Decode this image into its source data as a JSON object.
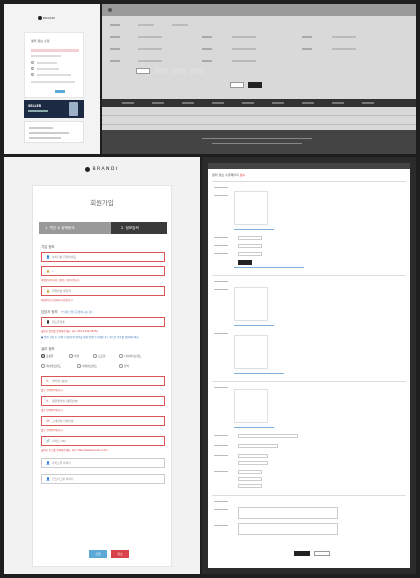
{
  "signup": {
    "brand_name": "BRANDI",
    "page_title": "회원가입",
    "steps": [
      {
        "label": "1. 약관 & 정책동의"
      },
      {
        "label": "2. 정보입력"
      }
    ],
    "section_basic": "가입 정보",
    "section_manager": "담당자 정보",
    "section_manager_sub": "(*실제 샵을 운영하시는 분)",
    "section_shop": "셀러 정보",
    "fields": [
      {
        "icon": "user-icon",
        "glyph": "👤",
        "text": "아이디를 입력하세요",
        "error": true
      },
      {
        "icon": "lock-icon",
        "glyph": "🔒",
        "text": "•",
        "error": true
      },
      {
        "icon": "lock-icon",
        "glyph": "🔒",
        "text": "비밀번호 재입력",
        "error": true
      },
      {
        "icon": "phone-icon",
        "glyph": "📱",
        "text": "핸드폰번호",
        "error": true
      },
      {
        "icon": "pencil-icon",
        "glyph": "✎",
        "text": "셀러명 (상호)",
        "error": true
      },
      {
        "icon": "pencil-icon",
        "glyph": "✎",
        "text": "영문셀러명 (영문상호)",
        "error": true
      },
      {
        "icon": "phone-icon",
        "glyph": "☏",
        "text": "고객센터 전화번호",
        "error": true
      },
      {
        "icon": "link-icon",
        "glyph": "🔗",
        "text": "사이트 URL",
        "error": true
      },
      {
        "icon": "user-icon",
        "glyph": "👤",
        "text": "카카오톡 아이디",
        "error": false
      },
      {
        "icon": "user-icon",
        "glyph": "👤",
        "text": "인스타그램 아이디",
        "error": false
      }
    ],
    "errors": {
      "id": "아이디의 최소 길이는 5글자입니다.",
      "pw": "비밀번호의 최소 길이는 4글자입니다.",
      "pw2": "비밀번호가 일치하지 않습니다.",
      "phone": "올바른 정보를 입력해주세요. (ex. 010-1234-5678)",
      "name": "필수 입력항목입니다.",
      "name_en": "필수 입력항목입니다.",
      "cs": "필수 입력항목입니다.",
      "url": "올바른 주소를 입력해주세요. (ex. http://www.brandi.co.kr)"
    },
    "manager_note": "● 입점 신청 후 브랜디 담당자와 연락을 통해 입점이 진행됩니다. 핸드폰 번호를 확인해주세요.",
    "shop_types": [
      {
        "label": "쇼핑몰",
        "selected": true
      },
      {
        "label": "마켓",
        "selected": false
      },
      {
        "label": "로드샵",
        "selected": false
      },
      {
        "label": "디자이너브랜드",
        "selected": false
      },
      {
        "label": "제너럴브랜드",
        "selected": false
      },
      {
        "label": "내셔널브랜드",
        "selected": false
      },
      {
        "label": "뷰티",
        "selected": false
      }
    ],
    "submit_label": "신청",
    "cancel_label": "취소"
  },
  "mobile_preview": {
    "card_title": "셀러 정보 수정",
    "banner_title": "SELLER"
  },
  "admin_form": {
    "title": "셀러 정보 수정페이지",
    "title_tag": "필수"
  },
  "colors": {
    "error": "#dd3333",
    "primary_blue": "#5aa9d6",
    "cancel_red": "#d9424b",
    "step_dark": "#3a3a3a"
  }
}
